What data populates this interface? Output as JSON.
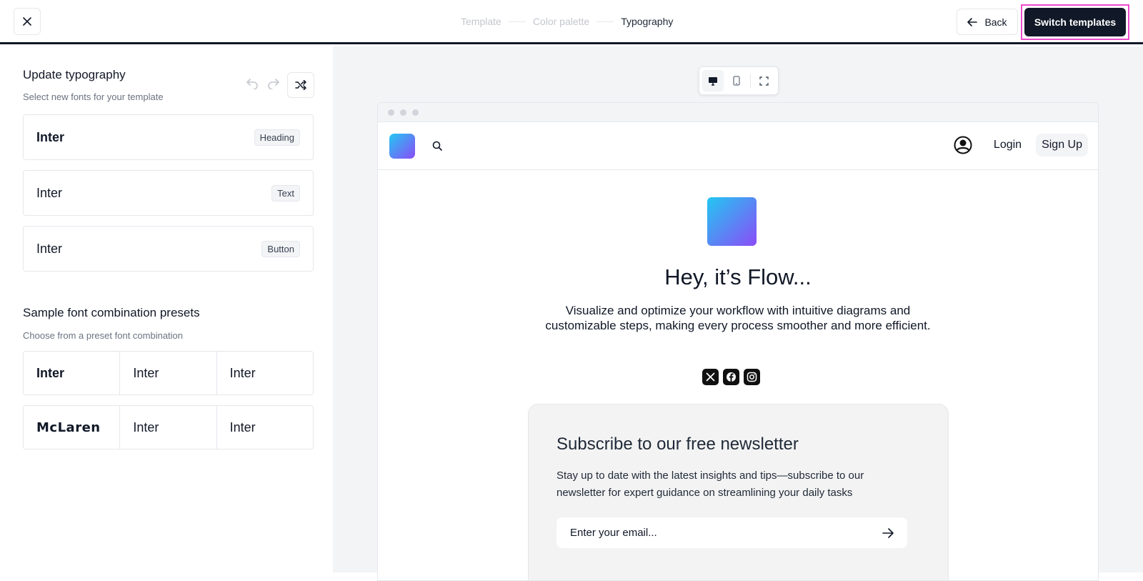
{
  "topbar": {
    "close_icon": "close-icon",
    "steps": [
      {
        "label": "Template",
        "state": "done"
      },
      {
        "label": "Color palette",
        "state": "done"
      },
      {
        "label": "Typography",
        "state": "active"
      }
    ],
    "back_label": "Back",
    "switch_label": "Switch templates"
  },
  "typography": {
    "title": "Update typography",
    "subtitle": "Select new fonts for your template",
    "rows": [
      {
        "font": "Inter",
        "tag": "Heading"
      },
      {
        "font": "Inter",
        "tag": "Text"
      },
      {
        "font": "Inter",
        "tag": "Button"
      }
    ]
  },
  "presets": {
    "title": "Sample font combination presets",
    "subtitle": "Choose from a preset font combination",
    "items": [
      [
        "Inter",
        "Inter",
        "Inter"
      ],
      [
        "McLaren",
        "Inter",
        "Inter"
      ]
    ]
  },
  "preview": {
    "nav": {
      "login": "Login",
      "signup": "Sign Up"
    },
    "hero": {
      "title": "Hey, it’s Flow...",
      "description": "Visualize and optimize your workflow with intuitive diagrams and customizable steps, making every process smoother and more efficient."
    },
    "newsletter": {
      "title": "Subscribe to our free newsletter",
      "description": "Stay up to date with the latest insights and tips—subscribe to our newsletter for expert guidance on streamlining your daily tasks",
      "email_placeholder": "Enter your email..."
    }
  },
  "colors": {
    "primary_dark": "#111827",
    "highlight": "#ec4bcb",
    "gradient_start": "#22c7f2",
    "gradient_end": "#8b4cf7"
  }
}
